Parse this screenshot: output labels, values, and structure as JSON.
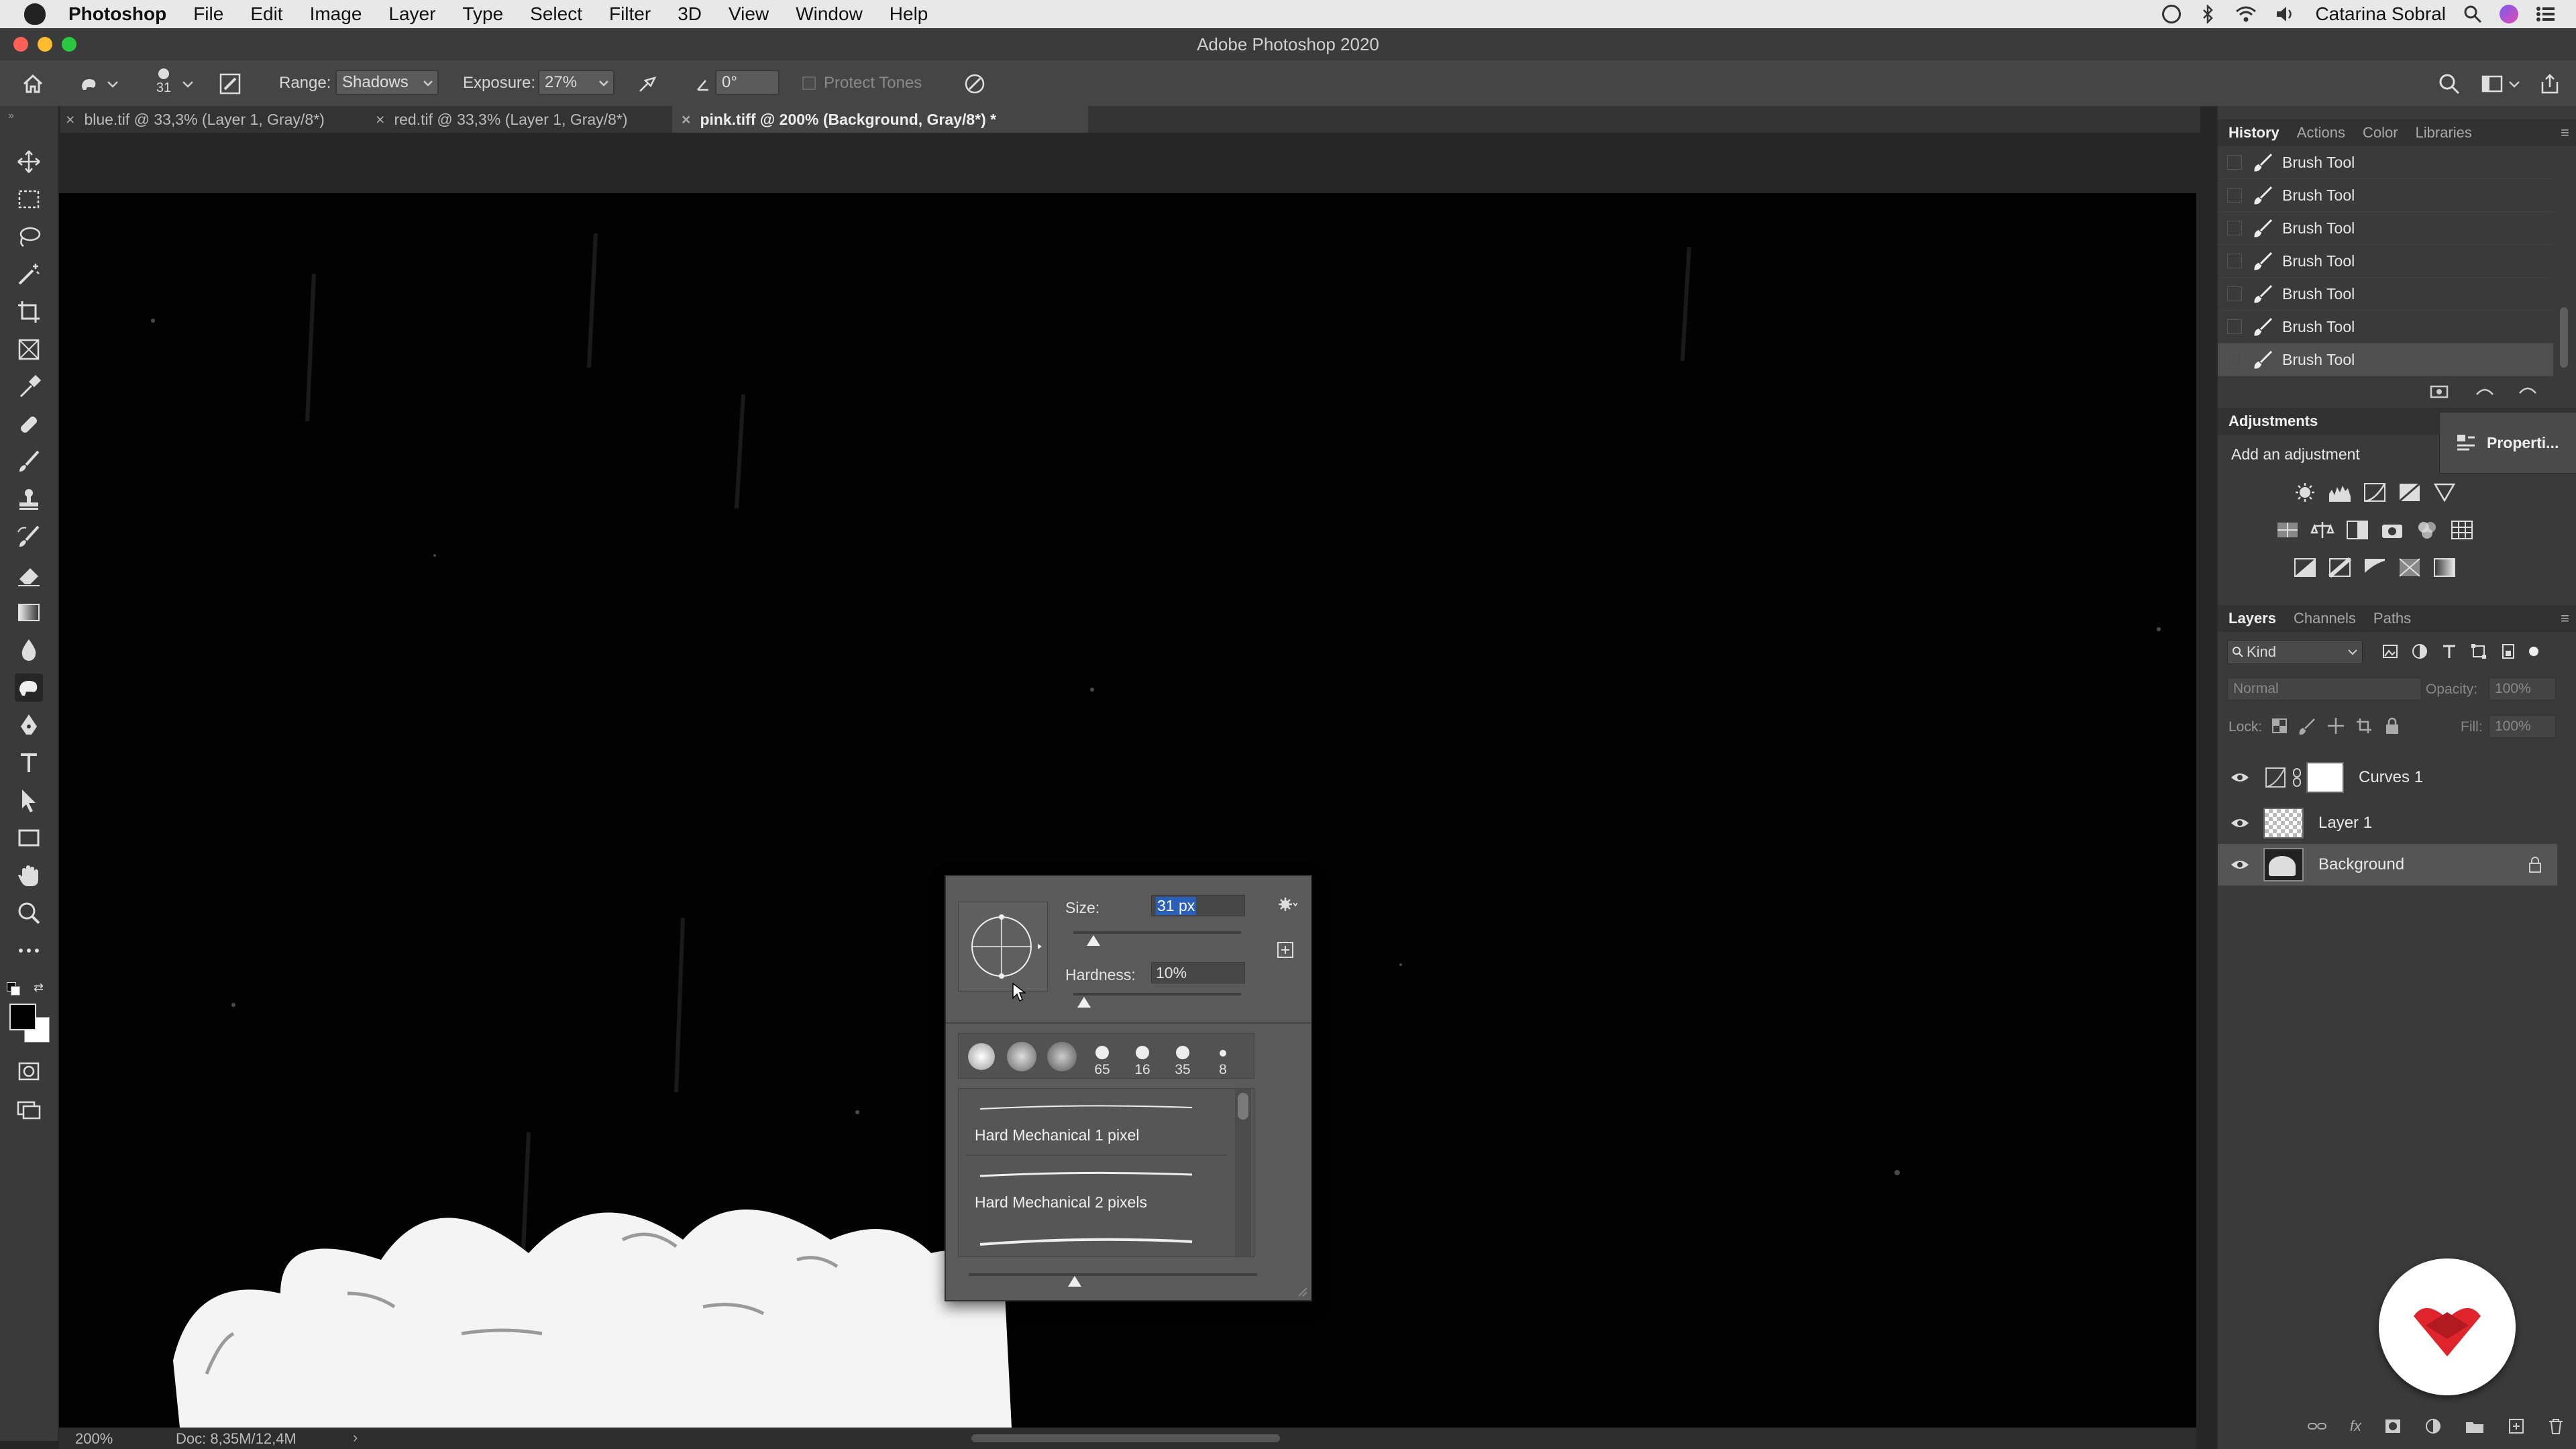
{
  "menubar": {
    "app_name": "Photoshop",
    "items": [
      "File",
      "Edit",
      "Image",
      "Layer",
      "Type",
      "Select",
      "Filter",
      "3D",
      "View",
      "Window",
      "Help"
    ],
    "user": "Catarina Sobral"
  },
  "window": {
    "title": "Adobe Photoshop 2020"
  },
  "options": {
    "brush_size": "31",
    "range_label": "Range:",
    "range_value": "Shadows",
    "exposure_label": "Exposure:",
    "exposure_value": "27%",
    "angle_value": "0°",
    "protect_tones_label": "Protect Tones"
  },
  "tabs": [
    {
      "label": "blue.tif @ 33,3% (Layer 1, Gray/8*)",
      "active": false
    },
    {
      "label": "red.tif @ 33,3% (Layer 1, Gray/8*)",
      "active": false
    },
    {
      "label": "pink.tiff @ 200% (Background, Gray/8*) *",
      "active": true
    }
  ],
  "status": {
    "zoom": "200%",
    "doc": "Doc: 8,35M/12,4M"
  },
  "history": {
    "tabs": [
      "History",
      "Actions",
      "Color",
      "Libraries"
    ],
    "items": [
      "Brush Tool",
      "Brush Tool",
      "Brush Tool",
      "Brush Tool",
      "Brush Tool",
      "Brush Tool",
      "Brush Tool"
    ]
  },
  "adjustments": {
    "title": "Adjustments",
    "subtitle": "Add an adjustment",
    "properties_label": "Properti..."
  },
  "layers": {
    "tabs": [
      "Layers",
      "Channels",
      "Paths"
    ],
    "filter": "Kind",
    "blend_mode": "Normal",
    "opacity_label": "Opacity:",
    "opacity_value": "100%",
    "lock_label": "Lock:",
    "fill_label": "Fill:",
    "fill_value": "100%",
    "items": [
      {
        "name": "Curves 1",
        "type": "adjustment"
      },
      {
        "name": "Layer 1",
        "type": "transparent"
      },
      {
        "name": "Background",
        "type": "image"
      }
    ]
  },
  "brush_popup": {
    "size_label": "Size:",
    "size_value": "31 px",
    "hardness_label": "Hardness:",
    "hardness_value": "10%",
    "presets": [
      "",
      "",
      "",
      "65",
      "16",
      "35",
      "8"
    ],
    "brushes": [
      "Hard Mechanical 1 pixel",
      "Hard Mechanical 2 pixels"
    ]
  },
  "colors": {
    "ui_dark": "#262626",
    "panel": "#3a3a3a",
    "selection": "#2a5fb8",
    "badge_red": "#e0242c"
  }
}
